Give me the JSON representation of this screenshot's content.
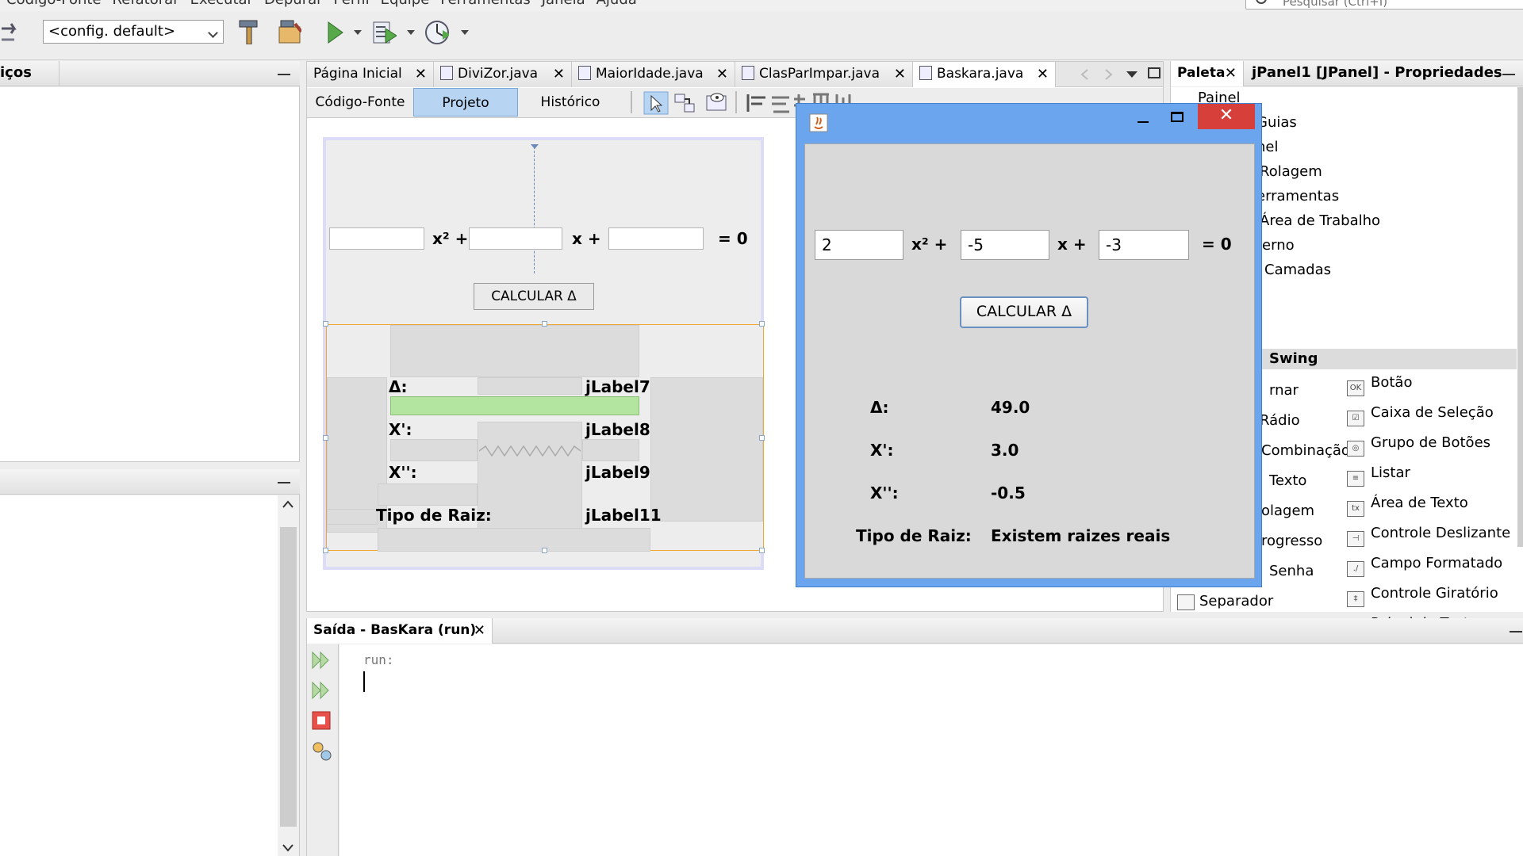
{
  "menubar": {
    "items": [
      "Código-Fonte",
      "Refatorar",
      "Executar",
      "Depurar",
      "Perfil",
      "Equipe",
      "Ferramentas",
      "Janela",
      "Ajuda"
    ],
    "search_placeholder": "Pesquisar (Ctrl+I)"
  },
  "toolbar": {
    "config_label": "<config. default>"
  },
  "left_panel": {
    "title": "iços"
  },
  "editor": {
    "tabs": [
      {
        "label": "Página Inicial"
      },
      {
        "label": "DiviZor.java"
      },
      {
        "label": "MaiorIdade.java"
      },
      {
        "label": "ClasParImpar.java"
      },
      {
        "label": "Baskara.java"
      }
    ],
    "subtabs": [
      "Código-Fonte",
      "Projeto",
      "Histórico"
    ]
  },
  "designer": {
    "x2_label": "x² +",
    "x_label": "x +",
    "eq_label": "= 0",
    "calc_label": "CALCULAR Δ",
    "delta_label": "Δ:",
    "x1_label": "X':",
    "x2r_label": "X'':",
    "tipo_label": "Tipo de Raiz:",
    "jlabel7": "jLabel7",
    "jlabel8": "jLabel8",
    "jlabel9": "jLabel9",
    "jlabel11": "jLabel11"
  },
  "app": {
    "close_symbol": "✕",
    "a_value": "2",
    "b_value": "-5",
    "c_value": "-3",
    "x2_label": "x² +",
    "x_label": "x +",
    "eq_label": "= 0",
    "calc_label": "CALCULAR Δ",
    "delta_label": "Δ:",
    "delta_value": "49.0",
    "x1_label": "X':",
    "x1_value": "3.0",
    "x2r_label": "X'':",
    "x2r_value": "-0.5",
    "tipo_label": "Tipo de Raiz:",
    "tipo_value": "Existem raizes reais"
  },
  "palette": {
    "tab_label": "Paleta",
    "props_title": "jPanel1 [JPanel] - Propriedades",
    "left_items": [
      "Painel",
      "Guias",
      "nel",
      "Rolagem",
      "erramentas",
      "Área de Trabalho",
      "terno",
      "Camadas"
    ],
    "section": "Swing",
    "swing_left": [
      "rnar",
      "Rádio",
      "Combinação",
      "Texto",
      "olagem",
      "rogresso",
      "Senha",
      "Separador"
    ],
    "swing_right": [
      {
        "label": "Botão",
        "icon": "OK"
      },
      {
        "label": "Caixa de Seleção",
        "icon": "☑"
      },
      {
        "label": "Grupo de Botões",
        "icon": "◎"
      },
      {
        "label": "Listar",
        "icon": "≡"
      },
      {
        "label": "Área de Texto",
        "icon": "tx"
      },
      {
        "label": "Controle Deslizante",
        "icon": "⊣"
      },
      {
        "label": "Campo Formatado",
        "icon": "./"
      },
      {
        "label": "Controle Giratório",
        "icon": "‡"
      },
      {
        "label": "Painel de Texto",
        "icon": "T"
      }
    ]
  },
  "output": {
    "tab_label": "Saída - BasKara (run)",
    "run_text": "run:"
  },
  "colors": {
    "window_blue": "#6aa5ee",
    "close_red": "#d7403a",
    "selection_orange": "#f0a830",
    "green_bar": "#b3e4a0"
  }
}
